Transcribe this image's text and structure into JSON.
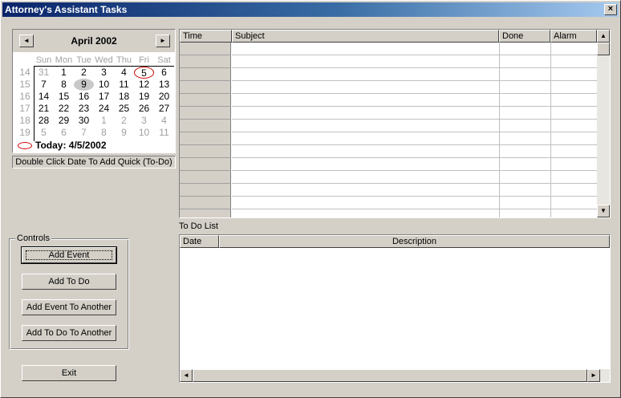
{
  "window": {
    "title": "Attorney's Assistant Tasks",
    "close_glyph": "×"
  },
  "calendar": {
    "month_title": "April 2002",
    "prev_glyph": "◄",
    "next_glyph": "►",
    "days_of_week": [
      "Sun",
      "Mon",
      "Tue",
      "Wed",
      "Thu",
      "Fri",
      "Sat"
    ],
    "weeks": [
      {
        "num": "14",
        "days": [
          "31",
          "1",
          "2",
          "3",
          "4",
          "5",
          "6"
        ]
      },
      {
        "num": "15",
        "days": [
          "7",
          "8",
          "9",
          "10",
          "11",
          "12",
          "13"
        ]
      },
      {
        "num": "16",
        "days": [
          "14",
          "15",
          "16",
          "17",
          "18",
          "19",
          "20"
        ]
      },
      {
        "num": "17",
        "days": [
          "21",
          "22",
          "23",
          "24",
          "25",
          "26",
          "27"
        ]
      },
      {
        "num": "18",
        "days": [
          "28",
          "29",
          "30",
          "1",
          "2",
          "3",
          "4"
        ]
      },
      {
        "num": "19",
        "days": [
          "5",
          "6",
          "7",
          "8",
          "9",
          "10",
          "11"
        ]
      }
    ],
    "today_text": "Today: 4/5/2002",
    "today_day": "5",
    "selected_day": "9"
  },
  "hint": "Double Click Date To Add Quick (To-Do)",
  "controls": {
    "group_label": "Controls",
    "add_event": "Add Event",
    "add_todo": "Add To Do",
    "add_event_another": "Add Event To Another",
    "add_todo_another": "Add To Do To Another",
    "exit": "Exit"
  },
  "events_grid": {
    "columns": [
      "Time",
      "Subject",
      "Done",
      "Alarm"
    ],
    "up_glyph": "▲",
    "down_glyph": "▼"
  },
  "todo": {
    "section_label": "To Do List",
    "columns": [
      "Date",
      "Description"
    ],
    "left_glyph": "◄",
    "right_glyph": "►"
  }
}
